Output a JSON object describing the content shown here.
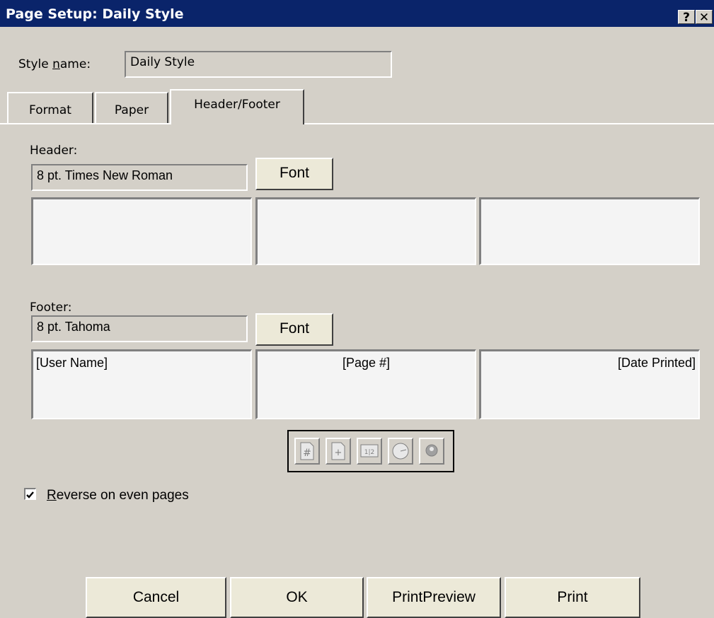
{
  "window": {
    "title": "Page Setup: Daily Style",
    "help_button": "?",
    "close_button": "✕"
  },
  "style_name": {
    "label_prefix": "Style ",
    "label_accel": "n",
    "label_suffix": "ame:",
    "value": "Daily Style"
  },
  "tabs": [
    {
      "label": "Format",
      "active": false
    },
    {
      "label": "Paper",
      "active": false
    },
    {
      "label": "Header/Footer",
      "active": true
    }
  ],
  "header": {
    "label": "Header:",
    "font_value": "8 pt. Times New Roman",
    "font_button": "Font",
    "left": "",
    "center": "",
    "right": ""
  },
  "footer": {
    "label": "Footer:",
    "font_value": "8 pt. Tahoma",
    "font_button": "Font",
    "left": "[User Name]",
    "center": "[Page #]",
    "right": "[Date Printed]"
  },
  "toolbar_icons": [
    "page-number-icon",
    "total-pages-icon",
    "date-icon",
    "time-icon",
    "user-name-icon"
  ],
  "reverse_checkbox": {
    "checked": true,
    "label_accel": "R",
    "label_rest": "everse on even pages"
  },
  "buttons": {
    "cancel": "Cancel",
    "ok": "OK",
    "print_preview": "PrintPreview",
    "print": "Print"
  },
  "colors": {
    "titlebar": "#0a246a",
    "dialog_face": "#d4d0c8",
    "button_face": "#ece9d8"
  }
}
